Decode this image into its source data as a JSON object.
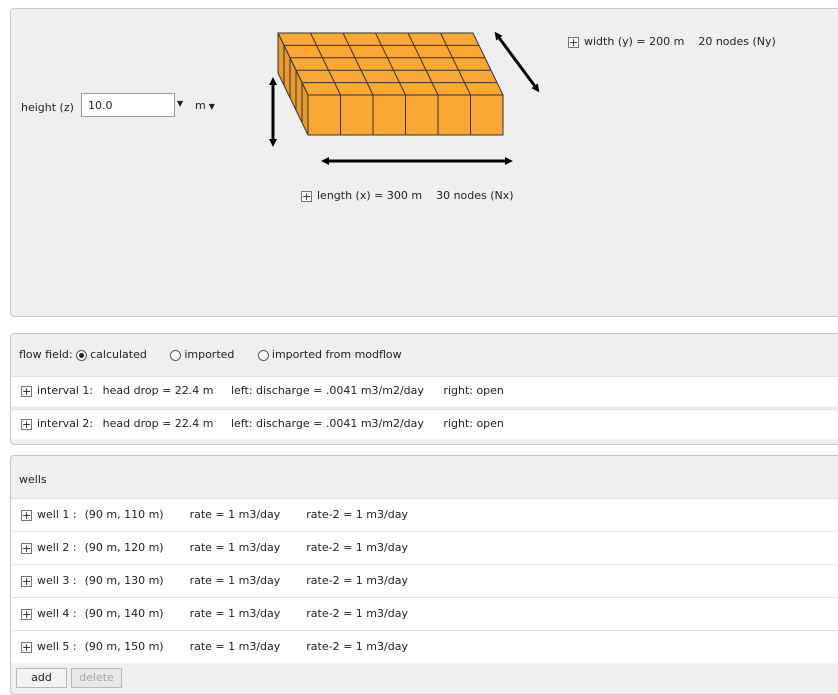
{
  "domain": {
    "height_label": "height (z)",
    "height_value": "10.0",
    "height_unit": "m",
    "width_text": "width (y) = 200 m",
    "width_nodes": "20 nodes (Ny)",
    "length_text": "length (x) = 300 m",
    "length_nodes": "30 nodes (Nx)",
    "box_color": "#f9a833"
  },
  "flow": {
    "label": "flow field:",
    "options": [
      "calculated",
      "imported",
      "imported from modflow"
    ],
    "selected": "calculated",
    "intervals": [
      {
        "name": "interval 1:",
        "head": "head drop = 22.4 m",
        "left": "left: discharge = .0041 m3/m2/day",
        "right": "right: open"
      },
      {
        "name": "interval 2:",
        "head": "head drop = 22.4 m",
        "left": "left: discharge = .0041 m3/m2/day",
        "right": "right: open"
      }
    ]
  },
  "wells": {
    "title": "wells",
    "items": [
      {
        "name": "well 1 :",
        "pos": "(90 m, 110 m)",
        "rate": "rate = 1 m3/day",
        "rate2": "rate-2 = 1 m3/day"
      },
      {
        "name": "well 2 :",
        "pos": "(90 m, 120 m)",
        "rate": "rate = 1 m3/day",
        "rate2": "rate-2 = 1 m3/day"
      },
      {
        "name": "well 3 :",
        "pos": "(90 m, 130 m)",
        "rate": "rate = 1 m3/day",
        "rate2": "rate-2 = 1 m3/day"
      },
      {
        "name": "well 4 :",
        "pos": "(90 m, 140 m)",
        "rate": "rate = 1 m3/day",
        "rate2": "rate-2 = 1 m3/day"
      },
      {
        "name": "well 5 :",
        "pos": "(90 m, 150 m)",
        "rate": "rate = 1 m3/day",
        "rate2": "rate-2 = 1 m3/day"
      }
    ],
    "add_label": "add",
    "delete_label": "delete"
  }
}
